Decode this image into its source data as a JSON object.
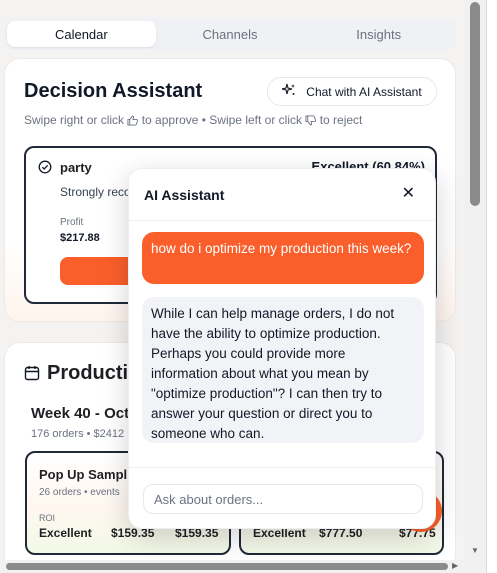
{
  "tabs": [
    {
      "label": "Calendar",
      "active": true
    },
    {
      "label": "Channels",
      "active": false
    },
    {
      "label": "Insights",
      "active": false
    }
  ],
  "decision": {
    "title": "Decision Assistant",
    "chat_button_label": "Chat with AI Assistant",
    "subtitle_part1": "Swipe right or click",
    "subtitle_part2": "to approve • Swipe left or click",
    "subtitle_part3": "to reject",
    "item": {
      "name": "party",
      "score": "Excellent (60.84%)",
      "description": "Strongly reco",
      "profit_label": "Profit",
      "profit_value": "$217.88"
    }
  },
  "production": {
    "title": "Production",
    "week_title": "Week 40 - Oct",
    "week_sub": "176 orders • $2412",
    "events": [
      {
        "name": "Pop Up Sampl",
        "sub": "26 orders • events",
        "roi_label": "ROI",
        "rating": "Excellent",
        "value1": "$159.35",
        "value2": "$159.35"
      },
      {
        "name": "",
        "sub": "",
        "roi_label": "",
        "rating": "Excellent",
        "value1": "$777.50",
        "value2": "$77.75"
      }
    ]
  },
  "chat": {
    "title": "AI Assistant",
    "close_glyph": "✕",
    "user_message": "how do i optimize my production this week?",
    "assistant_message": "While I can help manage orders, I do not have the ability to optimize production. Perhaps you could provide more information about what you mean by \"optimize production\"? I can then try to answer your question or direct you to someone who can.",
    "input_placeholder": "Ask about orders..."
  },
  "colors": {
    "accent": "#fa5f2b",
    "text_dark": "#111827",
    "text_muted": "#6b7280",
    "assistant_bubble": "#f1f3f7"
  },
  "icons": {
    "sparkle": "sparkle-icon",
    "thumbs_up": "thumbs-up-icon",
    "thumbs_down": "thumbs-down-icon",
    "check_circle": "check-circle-icon",
    "calendar": "calendar-icon",
    "close": "close-icon"
  }
}
